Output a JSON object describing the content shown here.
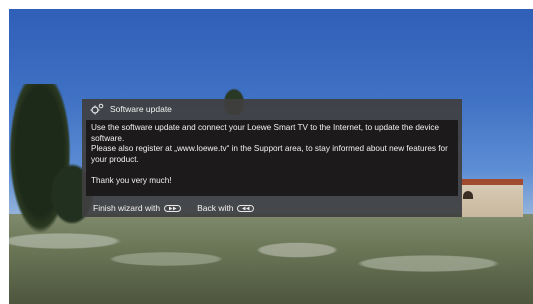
{
  "dialog": {
    "title": "Software update",
    "body": "Use the software update and connect your Loewe Smart TV to the Internet, to update the device software.\nPlease also register at „www.loewe.tv“ in the Support area, to stay informed about new features for your product.\n\nThank you very much!",
    "footer": {
      "finish_label": "Finish wizard with",
      "back_label": "Back with",
      "finish_icon": "fast-forward-key-icon",
      "back_icon": "rewind-key-icon"
    },
    "header_icon": "gears-icon"
  },
  "colors": {
    "panel": "#3f3f3f",
    "body_bg": "#1c1a1a",
    "text": "#f2f2f2"
  }
}
